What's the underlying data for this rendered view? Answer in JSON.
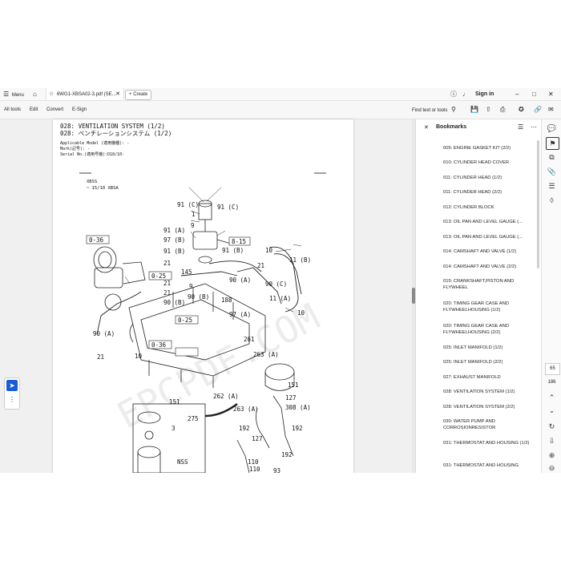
{
  "topbar": {
    "menu_label": "Menu",
    "file_tab": "6WG1-XBSA02-3.pdf (SE...",
    "create_label": "Create",
    "signin_label": "Sign in"
  },
  "toolbar": {
    "all_tools": "All tools",
    "edit": "Edit",
    "convert": "Convert",
    "esign": "E-Sign",
    "find": "Find text or tools"
  },
  "page": {
    "title_en": "028: VENTILATION SYSTEM (1/2)",
    "title_jp": "028: ベンチレーションシステム (1/2)",
    "applicable": "Applicable Model (適用機種): -",
    "mark": "Mark(記号): -",
    "serial": "Serial No.(適用号機):D18/10-",
    "model_a": "XBSS",
    "model_b": "~ 15/10 XBSA",
    "watermark": "EPCPDF.COM",
    "labels": [
      "91 (C)",
      "91 (C)",
      "1",
      "9",
      "91 (A)",
      "97 (B)",
      "91 (B)",
      "91 (B)",
      "8-15",
      "10",
      "11 (B)",
      "0-36",
      "145",
      "21",
      "21",
      "9",
      "90 (A)",
      "90 (C)",
      "0-25",
      "21",
      "90 (B)",
      "90 (B)",
      "21",
      "188",
      "11 (A)",
      "97 (A)",
      "10",
      "90 (A)",
      "0-25",
      "261",
      "21",
      "10",
      "0-36",
      "263 (A)",
      "151",
      "262 (A)",
      "127",
      "263 (A)",
      "308 (A)",
      "151",
      "275",
      "3",
      "192",
      "192",
      "NSS",
      "127",
      "192",
      "110",
      "110",
      "93"
    ]
  },
  "bookmarks": {
    "title": "Bookmarks",
    "items": [
      "005: ENGINE GASKET KIT (2/2)",
      "010: CYLINDER HEAD COVER",
      "011: CYLINDER HEAD (1/2)",
      "011: CYLINDER HEAD (2/2)",
      "012: CYLINDER BLOCK",
      "013: OIL PAN AND LEVEL GAUGE (...",
      "013: OIL PAN AND LEVEL GAUGE (...",
      "014: CAMSHAFT AND VALVE (1/2)",
      "014: CAMSHAFT AND VALVE (2/2)",
      "015: CRANKSHAFT,PISTON AND FLYWHEEL",
      "020: TIMING GEAR CASE AND FLYWHEELHOUSING (1/2)",
      "020: TIMING GEAR CASE AND FLYWHEELHOUSING (2/2)",
      "025: INLET MANIFOLD (1/2)",
      "025: INLET MANIFOLD (2/2)",
      "027: EXHAUST MANIFOLD",
      "028: VENTILATION SYSTEM (1/2)",
      "028: VENTILATION SYSTEM (2/2)",
      "030: WATER PUMP AND CORROSIONRESISTOR",
      "031: THERMOSTAT AND HOUSING (1/2)",
      "031: THERMOSTAT AND HOUSING"
    ]
  },
  "rail": {
    "current_page": "65",
    "total_pages": "186"
  },
  "colors": {
    "accent": "#1a5bd7",
    "panel_bg": "#ffffff",
    "chrome_bg": "#f7f7f7"
  }
}
